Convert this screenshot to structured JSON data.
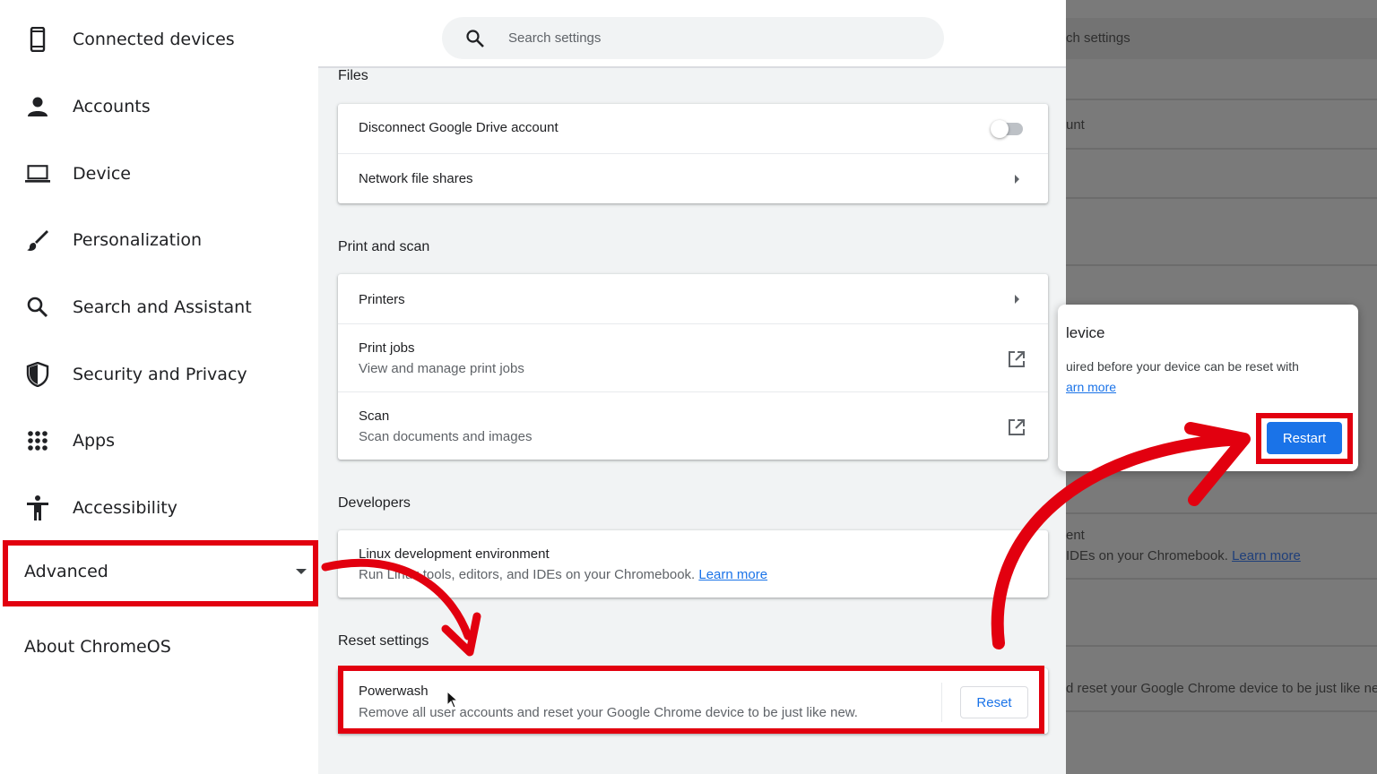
{
  "sidebar": {
    "items": [
      {
        "label": "Connected devices",
        "icon": "phone-icon"
      },
      {
        "label": "Accounts",
        "icon": "person-icon"
      },
      {
        "label": "Device",
        "icon": "laptop-icon"
      },
      {
        "label": "Personalization",
        "icon": "brush-icon"
      },
      {
        "label": "Search and Assistant",
        "icon": "search-icon"
      },
      {
        "label": "Security and Privacy",
        "icon": "shield-icon"
      },
      {
        "label": "Apps",
        "icon": "grid-icon"
      },
      {
        "label": "Accessibility",
        "icon": "accessibility-icon"
      }
    ],
    "advanced": "Advanced",
    "about": "About ChromeOS"
  },
  "search": {
    "placeholder": "Search settings"
  },
  "sections": {
    "files": {
      "title": "Files",
      "drive": "Disconnect Google Drive account",
      "drive_on": false,
      "shares": "Network file shares"
    },
    "print": {
      "title": "Print and scan",
      "printers": "Printers",
      "jobs": "Print jobs",
      "jobs_sub": "View and manage print jobs",
      "scan": "Scan",
      "scan_sub": "Scan documents and images"
    },
    "dev": {
      "title": "Developers",
      "linux": "Linux development environment",
      "linux_sub": "Run Linux tools, editors, and IDEs on your Chromebook.",
      "learn_more": "Learn more"
    },
    "reset": {
      "title": "Reset settings",
      "powerwash": "Powerwash",
      "powerwash_sub": "Remove all user accounts and reset your Google Chrome device to be just like new.",
      "button": "Reset"
    }
  },
  "right_panel": {
    "search_fragment": "ch settings",
    "account_fragment": "unt",
    "dev_fragment1": "ent",
    "dev_fragment2": "IDEs on your Chromebook.",
    "learn_more": "Learn more",
    "reset_fragment": "d reset your Google Chrome device to be just like new.",
    "dialog": {
      "title_fragment": "levice",
      "body_fragment": "uired before your device can be reset with",
      "link_fragment": "arn more",
      "restart": "Restart"
    }
  },
  "colors": {
    "annotation_red": "#e2000f",
    "accent_blue": "#1a73e8"
  }
}
